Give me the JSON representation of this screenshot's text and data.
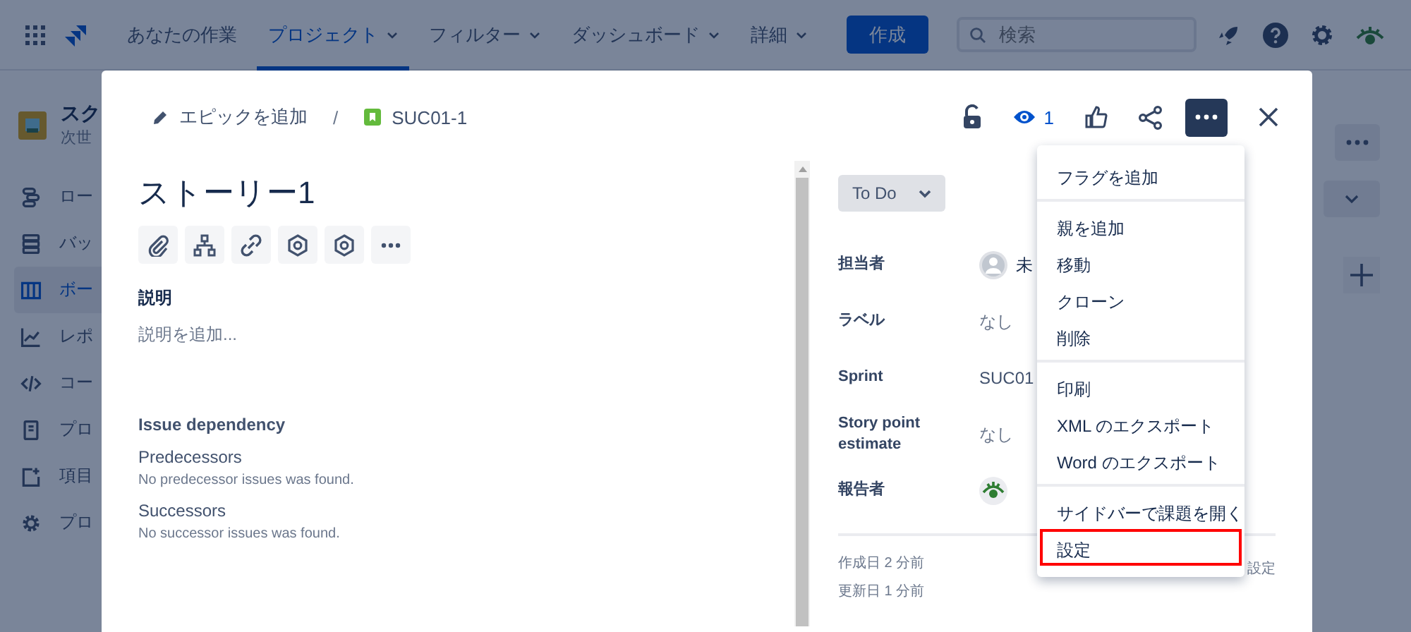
{
  "nav": {
    "items": [
      {
        "label": "あなたの作業",
        "selected": false,
        "dropdown": false
      },
      {
        "label": "プロジェクト",
        "selected": true,
        "dropdown": true
      },
      {
        "label": "フィルター",
        "selected": false,
        "dropdown": true
      },
      {
        "label": "ダッシュボード",
        "selected": false,
        "dropdown": true
      },
      {
        "label": "詳細",
        "selected": false,
        "dropdown": true
      }
    ],
    "create_button": "作成",
    "search": {
      "placeholder": "検索"
    }
  },
  "sidebar": {
    "project_name": "スク",
    "project_type": "次世",
    "items": [
      {
        "label": "ロー",
        "selected": false
      },
      {
        "label": "バッ",
        "selected": false
      },
      {
        "label": "ボー",
        "selected": true
      },
      {
        "label": "レポ",
        "selected": false
      },
      {
        "label": "コー",
        "selected": false
      },
      {
        "label": "プロ",
        "selected": false
      },
      {
        "label": "項目",
        "selected": false
      },
      {
        "label": "プロ",
        "selected": false
      }
    ]
  },
  "issue": {
    "breadcrumb": {
      "epic": "エピックを追加",
      "separator": "/",
      "key": "SUC01-1"
    },
    "watch_count": "1",
    "title": "ストーリー1",
    "description_label": "説明",
    "description_placeholder": "説明を追加...",
    "dependency": {
      "title": "Issue dependency",
      "sections": [
        {
          "heading": "Predecessors",
          "message": "No predecessor issues was found."
        },
        {
          "heading": "Successors",
          "message": "No successor issues was found."
        }
      ]
    },
    "status": "To Do",
    "fields": [
      {
        "label": "担当者",
        "kind": "avatar",
        "value": "未"
      },
      {
        "label": "ラベル",
        "kind": "text",
        "value": "なし"
      },
      {
        "label": "Sprint",
        "kind": "sprint",
        "value": "SUC01"
      },
      {
        "label": "Story point estimate",
        "kind": "text",
        "value": "なし"
      },
      {
        "label": "報告者",
        "kind": "user"
      }
    ],
    "created": "作成日 2 分前",
    "updated": "更新日 1 分前",
    "settings_link": "設定"
  },
  "menu": {
    "groups": [
      {
        "items": [
          {
            "label": "フラグを追加",
            "highlighted": false
          }
        ]
      },
      {
        "items": [
          {
            "label": "親を追加",
            "highlighted": false
          },
          {
            "label": "移動",
            "highlighted": false
          },
          {
            "label": "クローン",
            "highlighted": false
          },
          {
            "label": "削除",
            "highlighted": false
          }
        ]
      },
      {
        "items": [
          {
            "label": "印刷",
            "highlighted": false
          },
          {
            "label": "XML のエクスポート",
            "highlighted": false
          },
          {
            "label": "Word のエクスポート",
            "highlighted": false
          }
        ]
      },
      {
        "items": [
          {
            "label": "サイドバーで課題を開く",
            "highlighted": false
          },
          {
            "label": "設定",
            "highlighted": true
          }
        ]
      }
    ]
  }
}
